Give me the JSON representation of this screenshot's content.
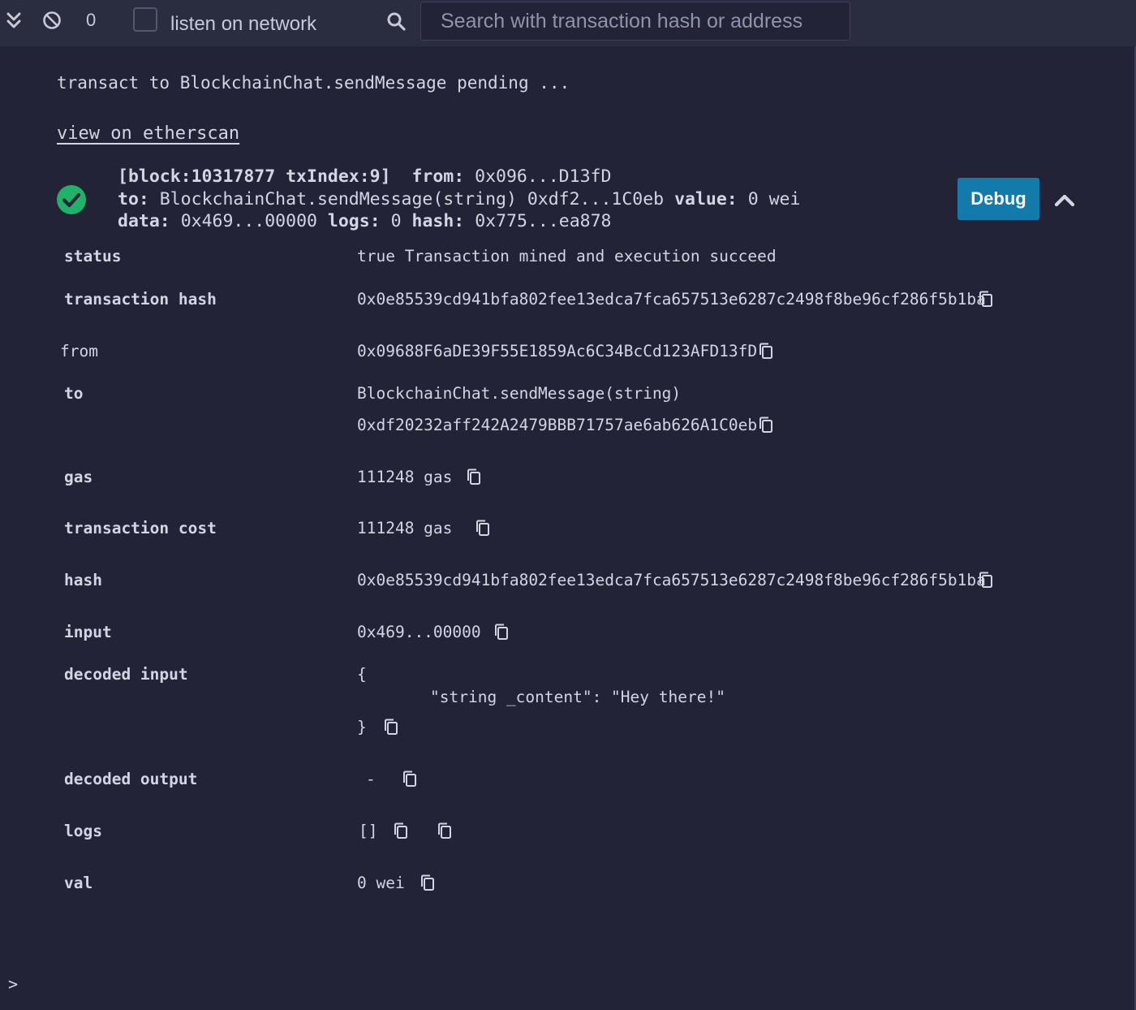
{
  "toolbar": {
    "tx_count": "0",
    "listen_label": "listen on network",
    "listen_checked": false,
    "search_placeholder": "Search with transaction hash or address"
  },
  "log": {
    "pending_line": "transact to BlockchainChat.sendMessage pending ...",
    "etherscan_link": "view on etherscan"
  },
  "summary": {
    "block_info": "[block:10317877 txIndex:9]",
    "from_label": "from:",
    "from_short": "0x096...D13fD",
    "to_label": "to:",
    "to_value": "BlockchainChat.sendMessage(string) 0xdf2...1C0eb",
    "value_label": "value:",
    "value_value": "0 wei",
    "data_label": "data:",
    "data_value": "0x469...00000",
    "logs_label": "logs:",
    "logs_value": "0",
    "hash_label": "hash:",
    "hash_value": "0x775...ea878",
    "debug_label": "Debug"
  },
  "details": {
    "status_label": "status",
    "status_value": "true Transaction mined and execution succeed",
    "tx_hash_label": "transaction hash",
    "tx_hash_value": "0x0e85539cd941bfa802fee13edca7fca657513e6287c2498f8be96cf286f5b1ba",
    "from_label": "from",
    "from_value": "0x09688F6aDE39F55E1859Ac6C34BcCd123AFD13fD",
    "to_label": "to",
    "to_value_line1": "BlockchainChat.sendMessage(string)",
    "to_value_line2": "0xdf20232aff242A2479BBB71757ae6ab626A1C0eb",
    "gas_label": "gas",
    "gas_value": "111248 gas",
    "tx_cost_label": "transaction cost",
    "tx_cost_value": "111248 gas",
    "hash_label": "hash",
    "hash_value": "0x0e85539cd941bfa802fee13edca7fca657513e6287c2498f8be96cf286f5b1ba",
    "input_label": "input",
    "input_value": "0x469...00000",
    "decoded_input_label": "decoded input",
    "decoded_input_open": "{",
    "decoded_input_entry": "\"string _content\": \"Hey there!\"",
    "decoded_input_close": "}",
    "decoded_output_label": "decoded output",
    "decoded_output_value": "-",
    "logs_label": "logs",
    "logs_value": "[]",
    "val_label": "val",
    "val_value": "0 wei"
  },
  "console": {
    "prompt": ">"
  },
  "colors": {
    "background": "#222336",
    "toolbar": "#2a2c3f",
    "text": "#d4d5e2",
    "debug_button": "#137bab",
    "success": "#1fb36a"
  }
}
